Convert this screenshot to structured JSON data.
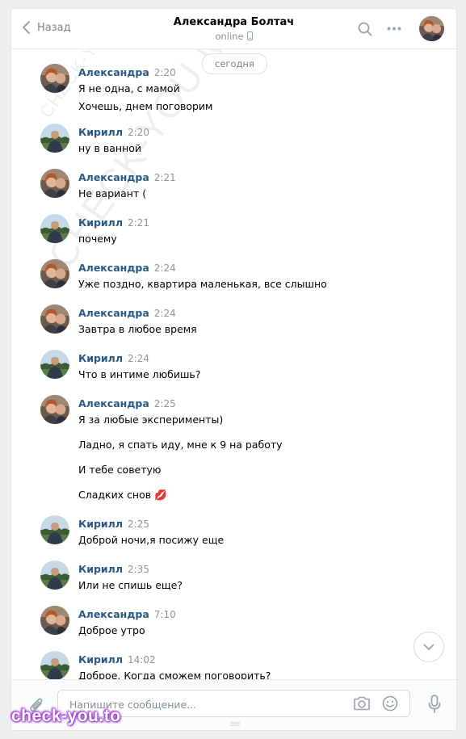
{
  "header": {
    "back_label": "Назад",
    "contact_name": "Александра Болтач",
    "status": "online"
  },
  "date_label": "сегодня",
  "messages": [
    {
      "author": "Александра",
      "time": "2:20",
      "lines": [
        "Я не одна, с мамой",
        "Хочешь, днем поговорим"
      ]
    },
    {
      "author": "Кирилл",
      "time": "2:20",
      "lines": [
        "ну в ванной"
      ]
    },
    {
      "author": "Александра",
      "time": "2:21",
      "lines": [
        "Не вариант ("
      ]
    },
    {
      "author": "Кирилл",
      "time": "2:21",
      "lines": [
        "почему"
      ]
    },
    {
      "author": "Александра",
      "time": "2:24",
      "lines": [
        "Уже поздно, квартира маленькая, все слышно"
      ]
    },
    {
      "author": "Александра",
      "time": "2:24",
      "lines": [
        "Завтра в любое время"
      ]
    },
    {
      "author": "Кирилл",
      "time": "2:24",
      "lines": [
        "Что в интиме любишь?"
      ]
    },
    {
      "author": "Александра",
      "time": "2:25",
      "lines": [
        "Я за любые эксперименты)",
        "Ладно, я спать иду, мне к 9 на работу",
        "И тебе советую",
        "Сладких снов 💋"
      ]
    },
    {
      "author": "Кирилл",
      "time": "2:25",
      "lines": [
        "Доброй ночи,я посижу еще"
      ]
    },
    {
      "author": "Кирилл",
      "time": "2:35",
      "lines": [
        "Или не спишь еще?"
      ]
    },
    {
      "author": "Александра",
      "time": "7:10",
      "lines": [
        "Доброе утро"
      ]
    },
    {
      "author": "Кирилл",
      "time": "14:02",
      "lines": [
        "Доброе. Когда сможем поговорить?"
      ]
    }
  ],
  "composer": {
    "placeholder": "Напишите сообщение..."
  },
  "watermarks": {
    "diagonal": "CHECK-YOU.ME",
    "bottom": "check-you.to"
  },
  "colors": {
    "author_link": "#2a5885",
    "muted": "#939393",
    "icon": "#99a2ad"
  },
  "icons": [
    "chevron-left-icon",
    "mobile-phone-icon",
    "search-icon",
    "more-dots-icon",
    "chevron-down-icon",
    "paperclip-icon",
    "camera-icon",
    "smile-icon",
    "microphone-icon"
  ]
}
